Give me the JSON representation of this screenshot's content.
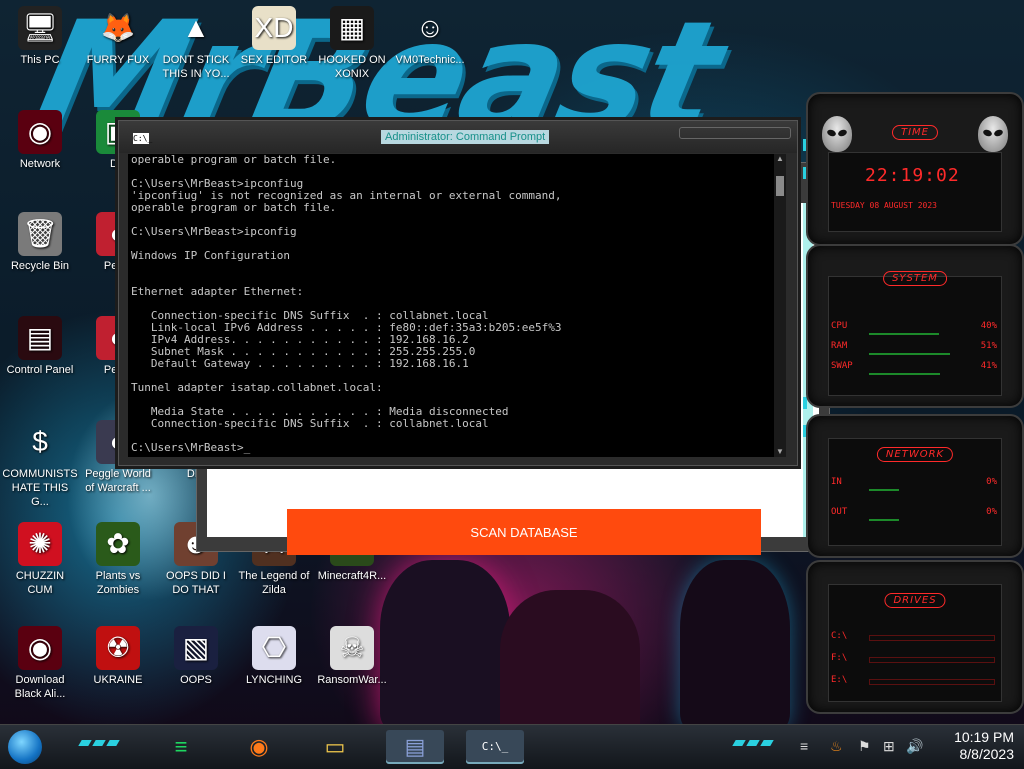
{
  "desktop": {
    "wallpaper_title": "MrBeast",
    "icons": [
      {
        "id": "this-pc",
        "label": "This PC",
        "glyph": "🖥"
      },
      {
        "id": "furry-fux",
        "label": "FURRY FUX",
        "glyph": "🦊"
      },
      {
        "id": "dont-stick",
        "label": "DONT STICK THIS IN YO...",
        "glyph": "▲"
      },
      {
        "id": "sex-editor",
        "label": "SEX EDITOR",
        "glyph": "XD"
      },
      {
        "id": "hooked-on-xonix",
        "label": "HOOKED ON XONIX",
        "glyph": "▦"
      },
      {
        "id": "vm0technic",
        "label": "VM0Technic...",
        "glyph": "☺"
      },
      {
        "id": "network",
        "label": "Network",
        "glyph": "◉"
      },
      {
        "id": "du",
        "label": "DU",
        "glyph": "▣"
      },
      {
        "id": "recycle-bin",
        "label": "Recycle Bin",
        "glyph": "🗑"
      },
      {
        "id": "peggl-1",
        "label": "Peggl",
        "glyph": "●"
      },
      {
        "id": "control-panel",
        "label": "Control Panel",
        "glyph": "▤"
      },
      {
        "id": "peggl-2",
        "label": "Peggl",
        "glyph": "●"
      },
      {
        "id": "communists",
        "label": "COMMUNISTS HATE THIS G...",
        "glyph": "$"
      },
      {
        "id": "peggle-world",
        "label": "Peggle World of Warcraft ...",
        "glyph": "●"
      },
      {
        "id": "die",
        "label": "DIE",
        "glyph": "✦"
      },
      {
        "id": "chuzzin",
        "label": "CHUZZIN CUM",
        "glyph": "✺"
      },
      {
        "id": "plants-zombies",
        "label": "Plants vs Zombies",
        "glyph": "✿"
      },
      {
        "id": "oops-did",
        "label": "OOPS DID I DO THAT",
        "glyph": "☻"
      },
      {
        "id": "legend-zilda",
        "label": "The Legend of Zilda",
        "glyph": "⚔"
      },
      {
        "id": "minecraft",
        "label": "Minecraft4R...",
        "glyph": "■"
      },
      {
        "id": "download-black",
        "label": "Download Black Ali...",
        "glyph": "◉"
      },
      {
        "id": "ukraine",
        "label": "UKRAINE",
        "glyph": "☢"
      },
      {
        "id": "oops",
        "label": "OOPS",
        "glyph": "▧"
      },
      {
        "id": "lynching",
        "label": "LYNCHING",
        "glyph": "⎔"
      },
      {
        "id": "ransomware",
        "label": "RansomWar...",
        "glyph": "☠"
      }
    ]
  },
  "cmd": {
    "icon_text": "C:\\_",
    "title": "Administrator: Command Prompt",
    "lines": [
      "operable program or batch file.",
      "",
      "C:\\Users\\MrBeast>ipconfiug",
      "'ipconfiug' is not recognized as an internal or external command,",
      "operable program or batch file.",
      "",
      "C:\\Users\\MrBeast>ipconfig",
      "",
      "Windows IP Configuration",
      "",
      "",
      "Ethernet adapter Ethernet:",
      "",
      "   Connection-specific DNS Suffix  . : collabnet.local",
      "   Link-local IPv6 Address . . . . . : fe80::def:35a3:b205:ee5f%3",
      "   IPv4 Address. . . . . . . . . . . : 192.168.16.2",
      "   Subnet Mask . . . . . . . . . . . : 255.255.255.0",
      "   Default Gateway . . . . . . . . . : 192.168.16.1",
      "",
      "Tunnel adapter isatap.collabnet.local:",
      "",
      "   Media State . . . . . . . . . . . : Media disconnected",
      "   Connection-specific DNS Suffix  . : collabnet.local",
      "",
      "C:\\Users\\MrBeast>_"
    ]
  },
  "app": {
    "scan_button": "SCAN DATABASE",
    "accent_color": "#ff4a0e"
  },
  "gadget": {
    "time_title": "TIME",
    "time": "22:19:02",
    "date": "TUESDAY 08 AUGUST 2023",
    "system_title": "SYSTEM",
    "system_rows": [
      {
        "label": "CPU",
        "value": "40%"
      },
      {
        "label": "RAM",
        "value": "51%"
      },
      {
        "label": "SWAP",
        "value": "41%"
      }
    ],
    "network_title": "NETWORK",
    "network_rows": [
      {
        "label": "IN",
        "value": "0%"
      },
      {
        "label": "OUT",
        "value": "0%"
      }
    ],
    "drives_title": "DRIVES",
    "drives": [
      "C:\\",
      "F:\\",
      "E:\\"
    ],
    "accent_color": "#ff2a2a"
  },
  "taskbar": {
    "apps": [
      {
        "id": "spotify",
        "glyph": "≡",
        "color": "#1ed760"
      },
      {
        "id": "firefox",
        "glyph": "◉",
        "color": "#ff7a1a"
      },
      {
        "id": "file-explorer",
        "glyph": "▭",
        "color": "#f2c94c"
      },
      {
        "id": "app-window",
        "glyph": "▤",
        "color": "#8aa0d8"
      },
      {
        "id": "command-prompt",
        "glyph": "C:\\_",
        "color": "#ffffff"
      }
    ],
    "clock_time": "10:19 PM",
    "clock_date": "8/8/2023"
  }
}
